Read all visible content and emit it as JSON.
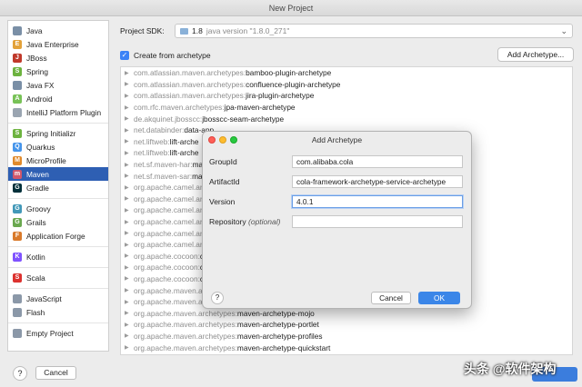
{
  "window": {
    "title": "New Project"
  },
  "sidebar": {
    "groups": [
      [
        {
          "label": "Java",
          "icon": "folder-icon",
          "color": "#7a8fa6"
        },
        {
          "label": "Java Enterprise",
          "icon": "java-enterprise-icon",
          "color": "#e3a23a"
        },
        {
          "label": "JBoss",
          "icon": "jboss-icon",
          "color": "#c0392b"
        },
        {
          "label": "Spring",
          "icon": "spring-icon",
          "color": "#6db33f"
        },
        {
          "label": "Java FX",
          "icon": "folder-icon",
          "color": "#7a8fa6"
        },
        {
          "label": "Android",
          "icon": "android-icon",
          "color": "#78c257"
        },
        {
          "label": "IntelliJ Platform Plugin",
          "icon": "plugin-icon",
          "color": "#9aa5b1"
        }
      ],
      [
        {
          "label": "Spring Initializr",
          "icon": "spring-initializr-icon",
          "color": "#6db33f"
        },
        {
          "label": "Quarkus",
          "icon": "quarkus-icon",
          "color": "#4695eb"
        },
        {
          "label": "MicroProfile",
          "icon": "microprofile-icon",
          "color": "#e08a2c"
        },
        {
          "label": "Maven",
          "icon": "maven-icon",
          "color": "#d0576b",
          "selected": true
        },
        {
          "label": "Gradle",
          "icon": "gradle-icon",
          "color": "#02303a"
        }
      ],
      [
        {
          "label": "Groovy",
          "icon": "groovy-icon",
          "color": "#4298b8"
        },
        {
          "label": "Grails",
          "icon": "grails-icon",
          "color": "#6aa84f"
        },
        {
          "label": "Application Forge",
          "icon": "forge-icon",
          "color": "#d97a2b"
        }
      ],
      [
        {
          "label": "Kotlin",
          "icon": "kotlin-icon",
          "color": "#7f52ff"
        }
      ],
      [
        {
          "label": "Scala",
          "icon": "scala-icon",
          "color": "#dc322f"
        }
      ],
      [
        {
          "label": "JavaScript",
          "icon": "javascript-icon",
          "color": "#8b98a8"
        },
        {
          "label": "Flash",
          "icon": "flash-icon",
          "color": "#8b98a8"
        }
      ],
      [
        {
          "label": "Empty Project",
          "icon": "empty-project-icon",
          "color": "#8b98a8"
        }
      ]
    ]
  },
  "sdk": {
    "label": "Project SDK:",
    "value": "1.8",
    "version": "java version \"1.8.0_271\""
  },
  "create_from_archetype": {
    "label": "Create from archetype",
    "checked": true
  },
  "add_archetype_button": "Add Archetype...",
  "archetypes": [
    {
      "group": "com.atlassian.maven.archetypes:",
      "artifact": "bamboo-plugin-archetype"
    },
    {
      "group": "com.atlassian.maven.archetypes:",
      "artifact": "confluence-plugin-archetype"
    },
    {
      "group": "com.atlassian.maven.archetypes:",
      "artifact": "jira-plugin-archetype"
    },
    {
      "group": "com.rfc.maven.archetypes:",
      "artifact": "jpa-maven-archetype"
    },
    {
      "group": "de.akquinet.jbosscc:",
      "artifact": "jbosscc-seam-archetype"
    },
    {
      "group": "net.databinder:",
      "artifact": "data-app"
    },
    {
      "group": "net.liftweb:",
      "artifact": "lift-arche"
    },
    {
      "group": "net.liftweb:",
      "artifact": "lift-arche"
    },
    {
      "group": "net.sf.maven-har:",
      "artifact": "ma"
    },
    {
      "group": "net.sf.maven-sar:",
      "artifact": "ma"
    },
    {
      "group": "org.apache.camel.ar",
      "artifact": ""
    },
    {
      "group": "org.apache.camel.ar",
      "artifact": ""
    },
    {
      "group": "org.apache.camel.ar",
      "artifact": ""
    },
    {
      "group": "org.apache.camel.ar",
      "artifact": ""
    },
    {
      "group": "org.apache.camel.ar",
      "artifact": ""
    },
    {
      "group": "org.apache.camel.ar",
      "artifact": ""
    },
    {
      "group": "org.apache.cocoon:",
      "artifact": "c"
    },
    {
      "group": "org.apache.cocoon:",
      "artifact": "c"
    },
    {
      "group": "org.apache.cocoon:",
      "artifact": "c"
    },
    {
      "group": "org.apache.maven.ar",
      "artifact": ""
    },
    {
      "group": "org.apache.maven.ar",
      "artifact": ""
    },
    {
      "group": "org.apache.maven.archetypes:",
      "artifact": "maven-archetype-mojo"
    },
    {
      "group": "org.apache.maven.archetypes:",
      "artifact": "maven-archetype-portlet"
    },
    {
      "group": "org.apache.maven.archetypes:",
      "artifact": "maven-archetype-profiles"
    },
    {
      "group": "org.apache.maven.archetypes:",
      "artifact": "maven-archetype-quickstart"
    }
  ],
  "footer": {
    "help": "?",
    "cancel": "Cancel"
  },
  "watermark": "头条 @软件架构",
  "dialog": {
    "title": "Add Archetype",
    "fields": {
      "group_id": {
        "label": "GroupId",
        "value": "com.alibaba.cola"
      },
      "artifact_id": {
        "label": "ArtifactId",
        "value": "cola-framework-archetype-service-archetype"
      },
      "version": {
        "label": "Version",
        "value": "4.0.1"
      },
      "repository": {
        "label": "Repository",
        "label_note": "(optional)",
        "value": ""
      }
    },
    "help": "?",
    "cancel": "Cancel",
    "ok": "OK"
  }
}
